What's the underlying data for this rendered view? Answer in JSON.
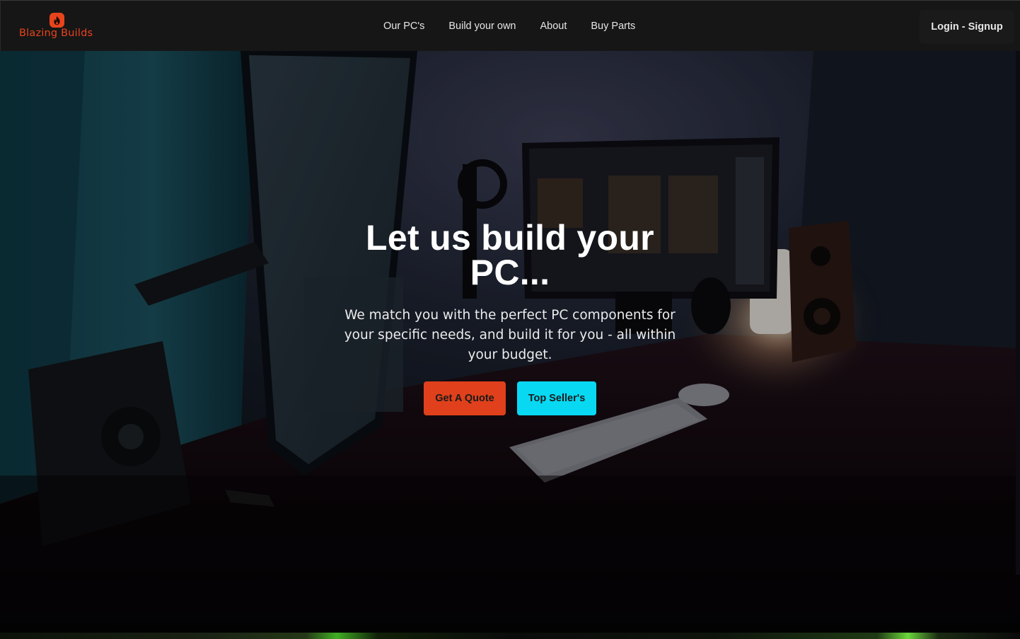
{
  "brand": {
    "name": "Blazing Builds",
    "icon": "flame-icon",
    "color": "#e8441c"
  },
  "nav": {
    "links": [
      {
        "label": "Our PC's"
      },
      {
        "label": "Build your own"
      },
      {
        "label": "About"
      },
      {
        "label": "Buy Parts"
      }
    ],
    "login_label": "Login - Signup"
  },
  "hero": {
    "title": "Let us build your PC...",
    "subtitle": "We match you with the perfect PC components for your specific needs, and build it for you - all within your budget.",
    "primary_button": "Get A Quote",
    "secondary_button": "Top Seller's",
    "background": "desk-setup-photo"
  },
  "colors": {
    "header_bg": "#161616",
    "primary": "#e0401b",
    "secondary": "#08d8f2"
  }
}
